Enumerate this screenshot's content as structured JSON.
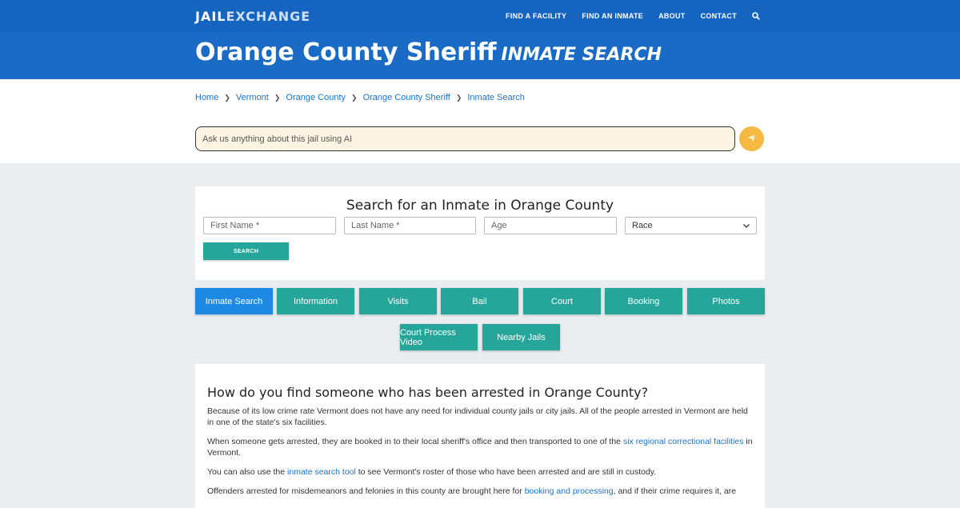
{
  "nav": {
    "logo_main": "JAIL",
    "logo_x": "EXCHANGE",
    "items": [
      "FIND A FACILITY",
      "FIND AN INMATE",
      "ABOUT",
      "CONTACT"
    ],
    "search_icon": "search-icon"
  },
  "header": {
    "title": "Orange County Sheriff",
    "subtitle": "INMATE SEARCH"
  },
  "breadcrumb": [
    "Home",
    "Vermont",
    "Orange County",
    "Orange County Sheriff",
    "Inmate Search"
  ],
  "ai": {
    "placeholder": "Ask us anything about this jail using AI",
    "send_icon": "paper-plane-icon"
  },
  "search_form": {
    "title": "Search for an Inmate in Orange County",
    "first_name_placeholder": "First Name *",
    "last_name_placeholder": "Last Name *",
    "age_placeholder": "Age",
    "race_selected": "Race",
    "button": "SEARCH"
  },
  "tabs": [
    "Inmate Search",
    "Information",
    "Visits",
    "Bail",
    "Court",
    "Booking",
    "Photos",
    "Court Process Video",
    "Nearby Jails"
  ],
  "active_tab": "Inmate Search",
  "article": {
    "heading": "How do you find someone who has been arrested in Orange County?",
    "p1": "Because of its low crime rate Vermont does not have any need for individual county jails or city jails. All of the people arrested in Vermont are held in one of the state's six facilities.",
    "p2_before": "When someone gets arrested, they are booked in to their local sheriff's office and then transported to one of the ",
    "p2_link": "six regional correctional facilities",
    "p2_after": " in Vermont.",
    "p3_before": "You can also use the ",
    "p3_link": "inmate search tool",
    "p3_after": " to see Vermont's roster of those who have been arrested and are still in custody.",
    "p4_before": "Offenders arrested for misdemeanors and felonies in this county are brought here for ",
    "p4_link": "booking and processing",
    "p4_after": ", and if their crime requires it, are"
  },
  "colors": {
    "nav_blue": "#1565c0",
    "header_blue": "#1a6bc6",
    "teal": "#26a69a",
    "active_blue": "#1e88e5",
    "link": "#1a73c8",
    "ai_send": "#f5b942"
  }
}
